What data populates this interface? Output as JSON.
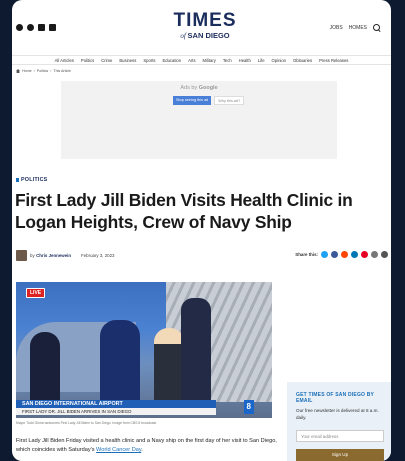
{
  "header": {
    "logo_top": "TIMES",
    "logo_of": "of",
    "logo_bottom": "SAN DIEGO",
    "social_icons": [
      "facebook-icon",
      "twitter-icon",
      "instagram-icon",
      "rss-icon"
    ],
    "links": [
      "JOBS",
      "HOMES"
    ]
  },
  "nav": {
    "items": [
      "All Articles",
      "Politics",
      "Crime",
      "Business",
      "Sports",
      "Education",
      "Arts",
      "Military",
      "Tech",
      "Health",
      "Life",
      "Opinion",
      "Obituaries",
      "Press Releases"
    ]
  },
  "breadcrumb": [
    "Home",
    "Politics",
    "This Article"
  ],
  "ad": {
    "prefix": "Ads by",
    "brand": "Google",
    "stop_label": "Stop seeing this ad",
    "why_label": "Why this ad?"
  },
  "article": {
    "category": "POLITICS",
    "headline": "First Lady Jill Biden Visits Health Clinic in Logan Heights, Crew of Navy Ship",
    "by": "by",
    "author": "Chris Jennewein",
    "date": "February 3, 2023",
    "share_label": "Share this:",
    "share_icons": [
      {
        "name": "twitter-share-icon",
        "color": "#1da1f2"
      },
      {
        "name": "facebook-share-icon",
        "color": "#3b5998"
      },
      {
        "name": "reddit-share-icon",
        "color": "#ff4500"
      },
      {
        "name": "linkedin-share-icon",
        "color": "#0077b5"
      },
      {
        "name": "pinterest-share-icon",
        "color": "#e60023"
      },
      {
        "name": "email-share-icon",
        "color": "#777777"
      },
      {
        "name": "print-share-icon",
        "color": "#555555"
      }
    ],
    "photo": {
      "live_badge": "LIVE",
      "lower_third_title": "SAN DIEGO INTERNATIONAL AIRPORT",
      "lower_third_sub": "FIRST LADY DR. JILL BIDEN ARRIVES IN SAN DIEGO",
      "channel": "8"
    },
    "caption": "Mayor Todd Gloria welcomes First Lady Jill Biden to San Diego. Image from CBS 8 broadcast",
    "body_text": "First Lady Jill Biden Friday visited a health clinic and a Navy ship on the first day of her visit to San Diego, which coincides with Saturday's ",
    "body_link": "World Cancer Day",
    "body_end": "."
  },
  "newsletter": {
    "heading": "GET TIMES OF SAN DIEGO BY EMAIL",
    "text": "Our free newsletter is delivered at 8 a.m. daily.",
    "email_placeholder": "Your email address",
    "signup_label": "Sign Up"
  }
}
